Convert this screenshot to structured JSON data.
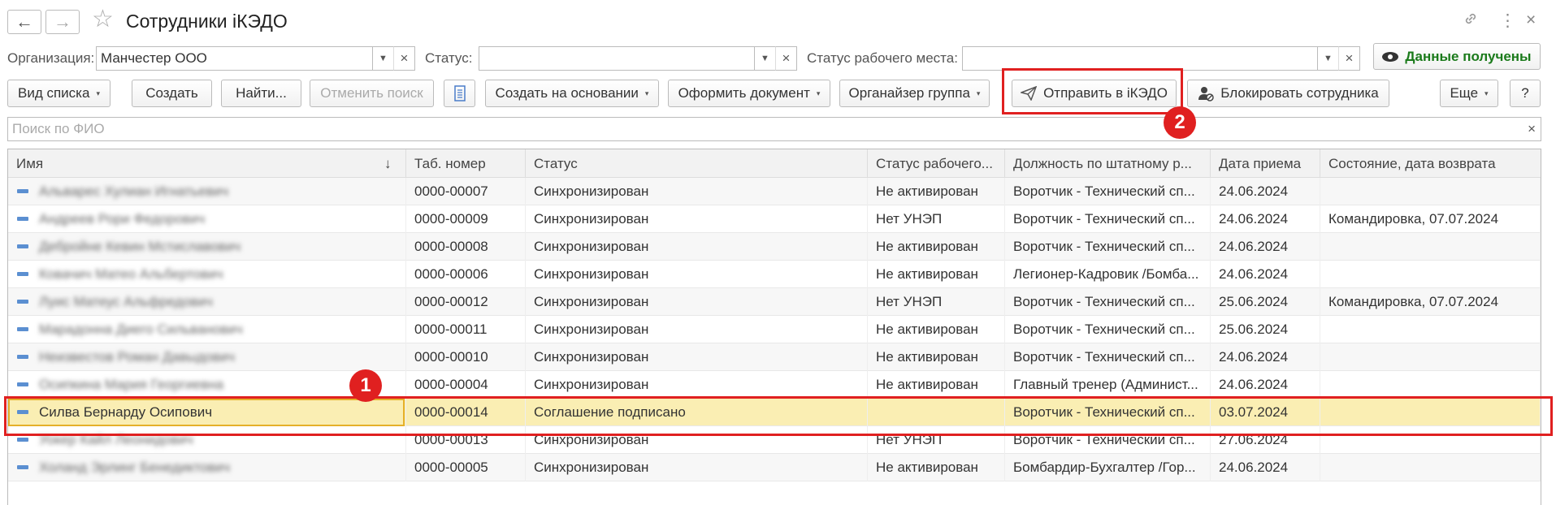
{
  "window": {
    "title": "Сотрудники iКЭДО",
    "back": "←",
    "forward": "→",
    "star": "☆",
    "link_glyph": "🔗",
    "more_glyph": "⋮",
    "close_glyph": "×"
  },
  "filters": {
    "org_label": "Организация:",
    "org_value": "Манчестер ООО",
    "status_label": "Статус:",
    "status_value": "",
    "workplace_label": "Статус рабочего места:",
    "workplace_value": "",
    "data_received": "Данные получены",
    "dd_glyph": "▼",
    "clear_glyph": "×"
  },
  "toolbar": {
    "view_list": "Вид списка",
    "create": "Создать",
    "find": "Найти...",
    "cancel_search": "Отменить поиск",
    "create_based": "Создать на основании",
    "make_doc": "Оформить документ",
    "organizer_group": "Органайзер группа",
    "send_ikedo": "Отправить в iКЭДО",
    "block_employee": "Блокировать сотрудника",
    "more": "Еще",
    "help": "?",
    "dd_glyph": "▾"
  },
  "search": {
    "placeholder": "Поиск по ФИО",
    "clear": "×"
  },
  "table": {
    "headers": [
      "Имя",
      "Таб. номер",
      "Статус",
      "Статус рабочего...",
      "Должность по штатному р...",
      "Дата приема",
      "Состояние, дата возврата"
    ],
    "sort_indicator": "↓",
    "rows": [
      {
        "name": "Альварес Хулиан Игнатьевич",
        "tab": "0000-00007",
        "status": "Синхронизирован",
        "workplace": "Не активирован",
        "position": "Воротчик - Технический сп...",
        "date": "24.06.2024",
        "state": "",
        "blurred": true
      },
      {
        "name": "Андреев Рори Федорович",
        "tab": "0000-00009",
        "status": "Синхронизирован",
        "workplace": "Нет УНЭП",
        "position": "Воротчик - Технический сп...",
        "date": "24.06.2024",
        "state": "Командировка, 07.07.2024",
        "blurred": true
      },
      {
        "name": "Дебройне Кевин Мстиславович",
        "tab": "0000-00008",
        "status": "Синхронизирован",
        "workplace": "Не активирован",
        "position": "Воротчик - Технический сп...",
        "date": "24.06.2024",
        "state": "",
        "blurred": true
      },
      {
        "name": "Ковачич Матео Альбертович",
        "tab": "0000-00006",
        "status": "Синхронизирован",
        "workplace": "Не активирован",
        "position": "Легионер-Кадровик /Бомба...",
        "date": "24.06.2024",
        "state": "",
        "blurred": true
      },
      {
        "name": "Луис Матеус Альфредович",
        "tab": "0000-00012",
        "status": "Синхронизирован",
        "workplace": "Нет УНЭП",
        "position": "Воротчик - Технический сп...",
        "date": "25.06.2024",
        "state": "Командировка, 07.07.2024",
        "blurred": true
      },
      {
        "name": "Марадонна Диего Сильванович",
        "tab": "0000-00011",
        "status": "Синхронизирован",
        "workplace": "Не активирован",
        "position": "Воротчик - Технический сп...",
        "date": "25.06.2024",
        "state": "",
        "blurred": true
      },
      {
        "name": "Неизвестов Роман Давыдович",
        "tab": "0000-00010",
        "status": "Синхронизирован",
        "workplace": "Не активирован",
        "position": "Воротчик - Технический сп...",
        "date": "24.06.2024",
        "state": "",
        "blurred": true
      },
      {
        "name": "Осипкина Мария Георгиевна",
        "tab": "0000-00004",
        "status": "Синхронизирован",
        "workplace": "Не активирован",
        "position": "Главный тренер (Админист...",
        "date": "24.06.2024",
        "state": "",
        "blurred": true
      },
      {
        "name": "Силва Бернарду Осипович",
        "tab": "0000-00014",
        "status": "Соглашение подписано",
        "workplace": "",
        "position": "Воротчик - Технический сп...",
        "date": "03.07.2024",
        "state": "",
        "blurred": false
      },
      {
        "name": "Уокер Кайл Леонидович",
        "tab": "0000-00013",
        "status": "Синхронизирован",
        "workplace": "Нет УНЭП",
        "position": "Воротчик - Технический сп...",
        "date": "27.06.2024",
        "state": "",
        "blurred": true
      },
      {
        "name": "Холанд Эрлинг Бенедиктович",
        "tab": "0000-00005",
        "status": "Синхронизирован",
        "workplace": "Не активирован",
        "position": "Бомбардир-Бухгалтер /Гор...",
        "date": "24.06.2024",
        "state": "",
        "blurred": true
      }
    ]
  },
  "annotations": {
    "badge1": "1",
    "badge2": "2"
  },
  "colors": {
    "selected_row": "#faeeb3",
    "highlight": "#e02020",
    "accent_green": "#1a7a1a"
  }
}
